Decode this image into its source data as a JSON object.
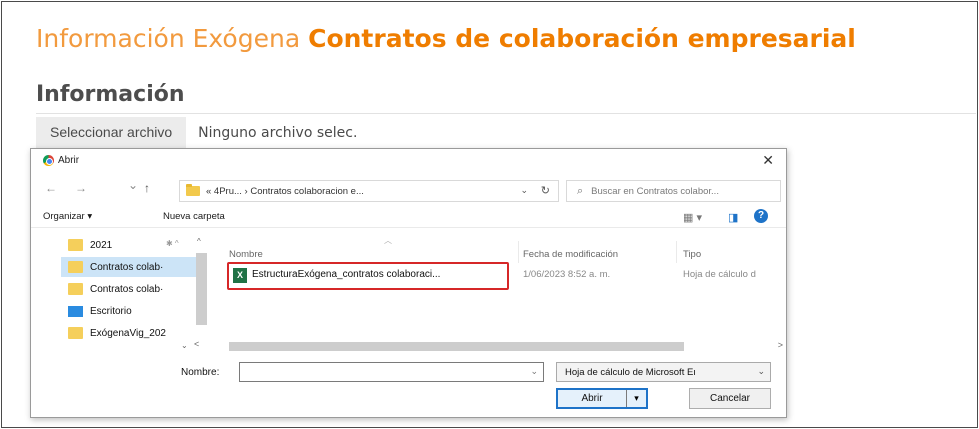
{
  "page": {
    "title_light": "Información Exógena ",
    "title_bold": "Contratos de colaboración empresarial",
    "section_title": "Información",
    "file_input": {
      "button_label": "Seleccionar archivo",
      "status": "Ninguno archivo selec."
    }
  },
  "dialog": {
    "title": "Abrir",
    "close_glyph": "✕",
    "nav": {
      "back": "←",
      "forward": "→",
      "recent": "⌄",
      "up": "↑",
      "address_path": "« 4Pru...  ›  Contratos colaboracion e...",
      "address_dropdown": "⌄",
      "refresh": "↻",
      "search_placeholder": "Buscar en Contratos colabor..."
    },
    "toolbar": {
      "organize": "Organizar ▾",
      "new_folder": "Nueva carpeta",
      "view_icon": "▦ ▾",
      "pane_icon": "◨",
      "help": "?"
    },
    "sidebar": {
      "items": [
        {
          "label": "2021",
          "icon": "folder-icon",
          "selected": false
        },
        {
          "label": "Contratos colab·",
          "icon": "folder-icon",
          "selected": true
        },
        {
          "label": "Contratos colab·",
          "icon": "folder-icon",
          "selected": false
        },
        {
          "label": "Escritorio",
          "icon": "desktop-icon",
          "selected": false
        },
        {
          "label": "ExógenaVig_202",
          "icon": "folder-icon",
          "selected": false
        }
      ],
      "pin_glyph": "✱ ^"
    },
    "file_list": {
      "columns": [
        "Nombre",
        "Fecha de modificación",
        "Tipo"
      ],
      "rows": [
        {
          "name": "EstructuraExógena_contratos colaboraci...",
          "date": "1/06/2023 8:52 a. m.",
          "type": "Hoja de cálculo d",
          "icon": "excel-icon"
        }
      ]
    },
    "bottom": {
      "name_label": "Nombre:",
      "name_value": "",
      "type_value": "Hoja de cálculo de Microsoft Eı",
      "open_label": "Abrir",
      "open_split": "▾",
      "cancel_label": "Cancelar"
    }
  },
  "colors": {
    "title_light": "#f29a3e",
    "title_bold": "#ef7d00",
    "highlight_border": "#d62728",
    "selection": "#cce4f7",
    "accent": "#1e73c8",
    "excel": "#1f7246"
  }
}
